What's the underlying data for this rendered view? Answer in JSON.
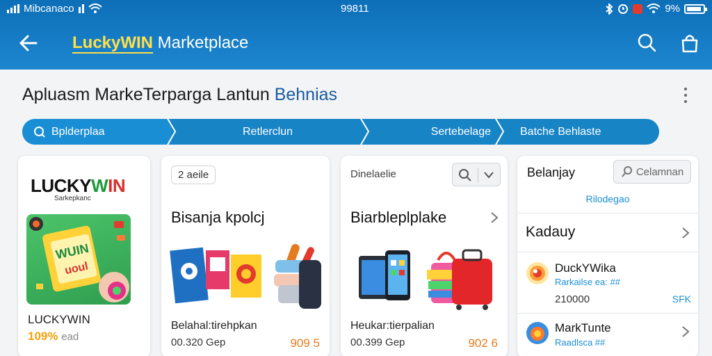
{
  "status_bar": {
    "carrier": "Mibcanaco",
    "time": "99811",
    "battery": "9%"
  },
  "header": {
    "brand": "LuckyWIN",
    "title_rest": " Marketplace"
  },
  "page": {
    "title_main": "Apluasm MarkeTerparga Lantun ",
    "title_highlight": "Behnias"
  },
  "stepper": {
    "steps": [
      "Bplderplaa",
      "Retlerclun",
      "Sertebelage",
      "Batche Behlaste"
    ]
  },
  "cards": [
    {
      "logo_parts": [
        "LUCKY",
        "W",
        "IN"
      ],
      "logo_sub": "Sarkepkanc",
      "promo_text": "WUIN",
      "promo_text2": "uoul",
      "name": "LUCKYWIN",
      "percent": "109%",
      "percent_suffix": "ead"
    },
    {
      "chip": "2 aeile",
      "heading": "Bisanja kpolcj",
      "product_name": "Belahal:tirehpkan",
      "meta": "00.320 Gep",
      "price": "909 5"
    },
    {
      "label": "Dinelaelie",
      "heading": "Biarbleplplake",
      "product_name": "Heukar:tierpalian",
      "meta": "00.399 Gep",
      "price": "902 6"
    },
    {
      "heading": "Belanjay",
      "button": "Celamnan",
      "link": "Rilodegao",
      "section": "Kadauy",
      "sellers": [
        {
          "name": "DuckYWika",
          "sub": "Rarkailse ea: ##",
          "meta": "210000",
          "tag": "SFK"
        },
        {
          "name": "MarkTunte",
          "sub": "Raadlsca ##"
        }
      ]
    }
  ],
  "colors": {
    "header": "#1784c6",
    "accent_orange": "#e57b1f",
    "link_blue": "#1a8ed4",
    "brand_yellow": "#ffe04a"
  }
}
